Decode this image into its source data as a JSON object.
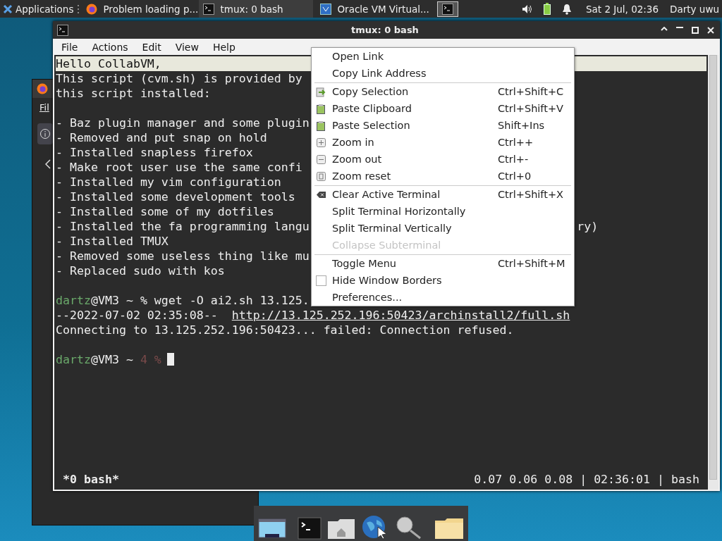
{
  "top_panel": {
    "apps_label": "Applications",
    "tasks": [
      {
        "title": "Problem loading p...",
        "selected": false
      },
      {
        "title": "tmux: 0 bash",
        "selected": true
      },
      {
        "title": "Oracle VM Virtual...",
        "selected": false
      }
    ],
    "clock": "Sat  2 Jul, 02:36",
    "user": "Darty uwu"
  },
  "back_window": {
    "menu_fragment": "Fil"
  },
  "terminal_window": {
    "title": "tmux: 0 bash",
    "menu": [
      "File",
      "Actions",
      "Edit",
      "View",
      "Help"
    ],
    "blocks": [
      {
        "lines": [
          {
            "highlight": true,
            "segments": [
              {
                "kind": "text",
                "text": "Hello CollabVM,"
              }
            ]
          },
          {
            "segments": [
              {
                "kind": "text",
                "text": "This script (cvm.sh) is provided by"
              }
            ]
          },
          {
            "segments": [
              {
                "kind": "text",
                "text": "this script installed:"
              }
            ]
          }
        ]
      },
      {
        "lines": [
          {
            "segments": [
              {
                "kind": "text",
                "text": "- Baz plugin manager and some plugin"
              }
            ]
          },
          {
            "segments": [
              {
                "kind": "text",
                "text": "- Removed and put snap on hold"
              }
            ]
          },
          {
            "segments": [
              {
                "kind": "text",
                "text": "- Installed snapless firefox"
              }
            ]
          },
          {
            "segments": [
              {
                "kind": "text",
                "text": "- Make root user use the same confi"
              }
            ]
          },
          {
            "segments": [
              {
                "kind": "text",
                "text": "- Installed my vim configuration"
              }
            ]
          },
          {
            "segments": [
              {
                "kind": "text",
                "text": "- Installed some development tools"
              }
            ]
          },
          {
            "segments": [
              {
                "kind": "text",
                "text": "- Installed some of my dotfiles"
              }
            ]
          },
          {
            "segments": [
              {
                "kind": "text",
                "text": "- Installed the fa programming langu"
              },
              {
                "kind": "fragment",
                "text": "ry)"
              }
            ]
          },
          {
            "segments": [
              {
                "kind": "text",
                "text": "- Installed TMUX"
              }
            ]
          },
          {
            "segments": [
              {
                "kind": "text",
                "text": "- Removed some useless thing like mu"
              }
            ]
          },
          {
            "segments": [
              {
                "kind": "text",
                "text": "- Replaced sudo with kos"
              }
            ]
          }
        ]
      },
      {
        "lines": [
          {
            "segments": [
              {
                "kind": "user",
                "text": "dartz"
              },
              {
                "kind": "text",
                "text": "@VM3 ~ % wget -O ai2.sh 13.125."
              }
            ]
          },
          {
            "segments": [
              {
                "kind": "text",
                "text": "--2022-07-02 02:35:08--  "
              },
              {
                "kind": "link",
                "text": "http://13.125.252.196:50423/archinstall2/full.sh"
              }
            ]
          },
          {
            "segments": [
              {
                "kind": "text",
                "text": "Connecting to 13.125.252.196:50423... failed: Connection refused."
              }
            ]
          }
        ]
      },
      {
        "lines": [
          {
            "cursor": true,
            "segments": [
              {
                "kind": "user",
                "text": "dartz"
              },
              {
                "kind": "text",
                "text": "@VM3 ~ "
              },
              {
                "kind": "dim",
                "text": "4 %"
              }
            ]
          }
        ]
      }
    ],
    "status_left": "*0 bash*",
    "status_right": "0.07 0.06 0.08 | 02:36:01 | bash"
  },
  "context_menu": [
    {
      "kind": "item",
      "label": "Open Link"
    },
    {
      "kind": "item",
      "label": "Copy Link Address"
    },
    {
      "kind": "separator"
    },
    {
      "kind": "copy",
      "label": "Copy Selection",
      "shortcut": "Ctrl+Shift+C"
    },
    {
      "kind": "paste",
      "label": "Paste Clipboard",
      "shortcut": "Ctrl+Shift+V"
    },
    {
      "kind": "paste",
      "label": "Paste Selection",
      "shortcut": "Shift+Ins"
    },
    {
      "kind": "zoomin",
      "label": "Zoom in",
      "shortcut": "Ctrl++"
    },
    {
      "kind": "zoomout",
      "label": "Zoom out",
      "shortcut": "Ctrl+-"
    },
    {
      "kind": "zoomreset",
      "label": "Zoom reset",
      "shortcut": "Ctrl+0"
    },
    {
      "kind": "separator"
    },
    {
      "kind": "clear",
      "label": "Clear Active Terminal",
      "shortcut": "Ctrl+Shift+X"
    },
    {
      "kind": "item",
      "label": "Split Terminal Horizontally"
    },
    {
      "kind": "item",
      "label": "Split Terminal Vertically"
    },
    {
      "kind": "item",
      "label": "Collapse Subterminal",
      "disabled": true
    },
    {
      "kind": "separator"
    },
    {
      "kind": "item",
      "label": "Toggle Menu",
      "shortcut": "Ctrl+Shift+M"
    },
    {
      "kind": "check",
      "label": "Hide Window Borders",
      "checked": false
    },
    {
      "kind": "item",
      "label": "Preferences..."
    }
  ]
}
